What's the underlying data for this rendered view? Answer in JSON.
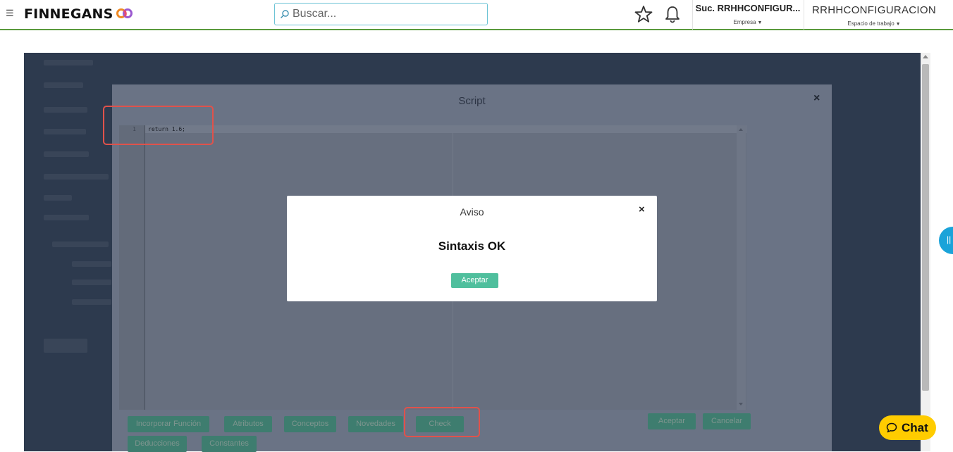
{
  "header": {
    "menu_icon": "hamburger-icon",
    "logo_text": "FINNEGANS",
    "search_placeholder": "Buscar...",
    "company_name": "Suc. RRHHCONFIGUR...",
    "company_sub": "Empresa",
    "workspace_name": "RRHHCONFIGURACION",
    "workspace_sub": "Espacio de trabajo",
    "accent": "#5a9a3c"
  },
  "script_modal": {
    "title": "Script",
    "close": "×",
    "editor": {
      "line_number": "1",
      "code": "return 1.6;"
    },
    "buttons_row1": [
      "Incorporar Función",
      "Atributos",
      "Conceptos",
      "Novedades",
      "Check"
    ],
    "buttons_row2": [
      "Deducciones",
      "Constantes"
    ],
    "accept_label": "Aceptar",
    "cancel_label": "Cancelar"
  },
  "dialog": {
    "title": "Aviso",
    "close": "×",
    "message": "Sintaxis OK",
    "ok_label": "Aceptar",
    "ok_color": "#4fbf9d"
  },
  "chat": {
    "label": "Chat",
    "color": "#ffcc00"
  },
  "side_tab": {
    "glyph": "||",
    "color": "#1aa3d9"
  }
}
